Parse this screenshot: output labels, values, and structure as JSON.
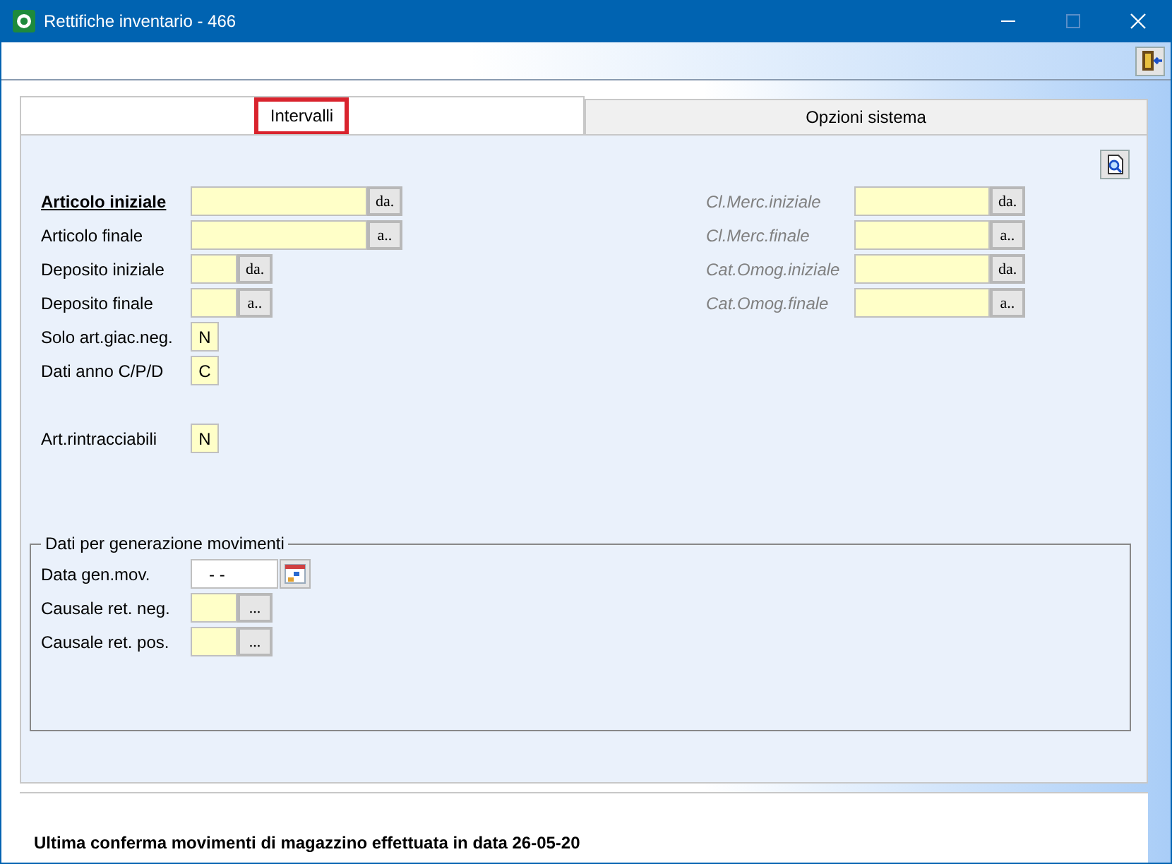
{
  "window": {
    "title": "Rettifiche inventario - 466"
  },
  "tabs": [
    {
      "label": "Intervalli",
      "selected": true,
      "highlighted": true
    },
    {
      "label": "Opzioni sistema",
      "selected": false,
      "highlighted": false
    }
  ],
  "left_fields": [
    {
      "label": "Articolo iniziale",
      "kind": "widelookup",
      "button": "da.",
      "emphasis": true,
      "disabled": false
    },
    {
      "label": "Articolo finale",
      "kind": "widelookup",
      "button": "a..",
      "emphasis": false,
      "disabled": false
    },
    {
      "label": "Deposito iniziale",
      "kind": "shortlookup",
      "button": "da.",
      "emphasis": false,
      "disabled": false
    },
    {
      "label": "Deposito finale",
      "kind": "shortlookup",
      "button": "a..",
      "emphasis": false,
      "disabled": false
    },
    {
      "label": "Solo art.giac.neg.",
      "kind": "flag",
      "value": "N",
      "emphasis": false,
      "disabled": false
    },
    {
      "label": "Dati anno C/P/D",
      "kind": "flag",
      "value": "C",
      "emphasis": false,
      "disabled": false
    }
  ],
  "extra_fields": [
    {
      "label": "Art.rintracciabili",
      "kind": "flag",
      "value": "N",
      "emphasis": false,
      "disabled": false
    }
  ],
  "right_fields": [
    {
      "label": "Cl.Merc.iniziale",
      "kind": "midlookup",
      "button": "da.",
      "emphasis": false,
      "disabled": true
    },
    {
      "label": "Cl.Merc.finale",
      "kind": "midlookup",
      "button": "a..",
      "emphasis": false,
      "disabled": true
    },
    {
      "label": "Cat.Omog.iniziale",
      "kind": "midlookup",
      "button": "da.",
      "emphasis": false,
      "disabled": true
    },
    {
      "label": "Cat.Omog.finale",
      "kind": "midlookup",
      "button": "a..",
      "emphasis": false,
      "disabled": true
    }
  ],
  "group": {
    "title": "Dati per generazione movimenti",
    "fields": [
      {
        "label": "Data gen.mov.",
        "kind": "date",
        "value": "- -",
        "emphasis": false,
        "disabled": false
      },
      {
        "label": "Causale ret. neg.",
        "kind": "shortlookup",
        "button": "...",
        "emphasis": false,
        "disabled": false
      },
      {
        "label": "Causale ret. pos.",
        "kind": "shortlookup",
        "button": "...",
        "emphasis": false,
        "disabled": false
      }
    ]
  },
  "status_bar": "Ultima conferma movimenti di magazzino effettuata in data 26-05-20"
}
